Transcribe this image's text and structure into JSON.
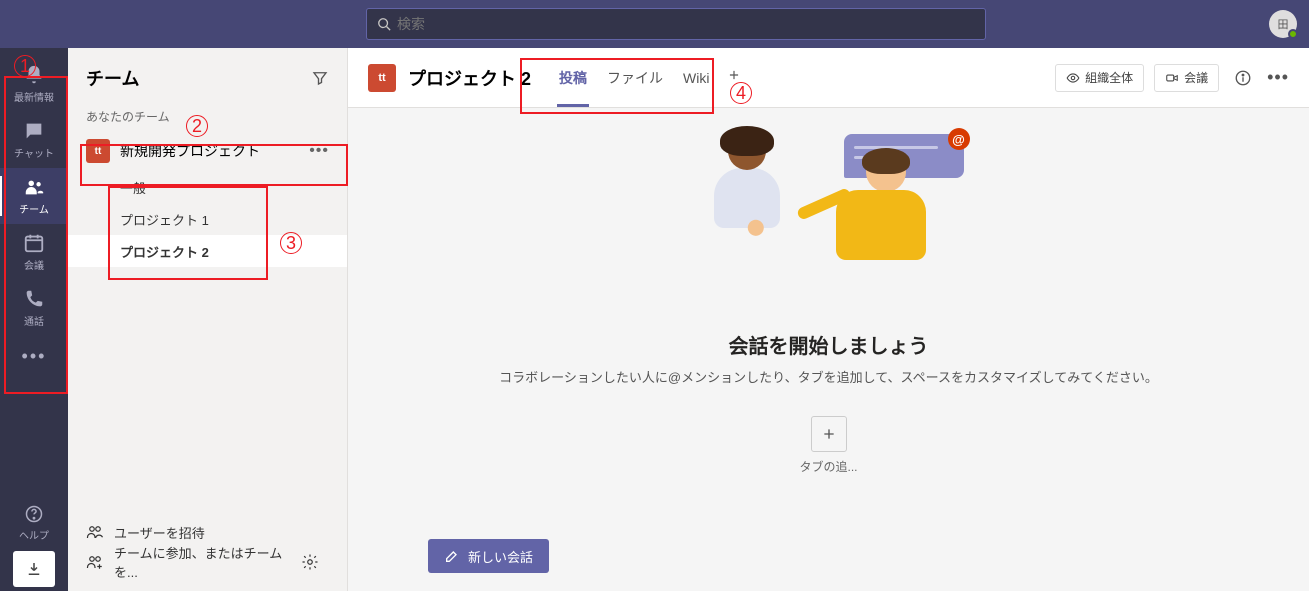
{
  "search": {
    "placeholder": "検索"
  },
  "avatar": {
    "initials": "田"
  },
  "rail": {
    "items": [
      {
        "label": "最新情報"
      },
      {
        "label": "チャット"
      },
      {
        "label": "チーム"
      },
      {
        "label": "会議"
      },
      {
        "label": "通話"
      }
    ],
    "help_label": "ヘルプ"
  },
  "list": {
    "header": "チーム",
    "your_teams_label": "あなたのチーム",
    "team": {
      "initials": "tt",
      "name": "新規開発プロジェクト"
    },
    "channels": [
      {
        "name": "一般"
      },
      {
        "name": "プロジェクト 1"
      },
      {
        "name": "プロジェクト 2"
      }
    ],
    "invite_label": "ユーザーを招待",
    "join_create_label": "チームに参加、またはチームを..."
  },
  "main": {
    "team_initials": "tt",
    "channel_name": "プロジェクト 2",
    "tabs": [
      {
        "label": "投稿"
      },
      {
        "label": "ファイル"
      },
      {
        "label": "Wiki"
      }
    ],
    "org_wide_label": "組織全体",
    "meet_label": "会議",
    "empty_title": "会話を開始しましょう",
    "empty_sub": "コラボレーションしたい人に@メンションしたり、タブを追加して、スペースをカスタマイズしてみてください。",
    "add_tab_label": "タブの追...",
    "new_convo_label": "新しい会話",
    "at_symbol": "@"
  },
  "annotations": {
    "n1": "1",
    "n2": "2",
    "n3": "3",
    "n4": "4"
  }
}
